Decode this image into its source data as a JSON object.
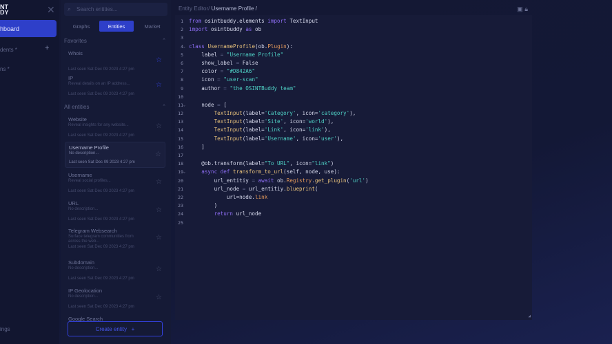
{
  "sidebar": {
    "logo_top": "NT",
    "logo_bottom": "DY",
    "items": [
      {
        "label": "hboard"
      },
      {
        "label": "dents *"
      },
      {
        "label": "ns *"
      }
    ],
    "settings_label": "ings"
  },
  "panel": {
    "search_placeholder": "Search entities...",
    "tabs": [
      {
        "label": "Graphs"
      },
      {
        "label": "Entities"
      },
      {
        "label": "Market"
      }
    ],
    "favorites_label": "Favorites",
    "all_label": "All entities",
    "favorites": [
      {
        "title": "Whois",
        "desc": "",
        "seen": "Last seen Sat Dec 09 2023 4:27 pm"
      },
      {
        "title": "IP",
        "desc": "Reveal details on an IP address...",
        "seen": "Last seen Sat Dec 09 2023 4:27 pm"
      }
    ],
    "entities": [
      {
        "title": "Website",
        "desc": "Reveal insights for any website...",
        "seen": "Last seen Sat Dec 09 2023 4:27 pm"
      },
      {
        "title": "Username Profile",
        "desc": "No description...",
        "seen": "Last seen Sat Dec 09 2023 4:27 pm"
      },
      {
        "title": "Username",
        "desc": "Reveal social profiles...",
        "seen": "Last seen Sat Dec 09 2023 4:27 pm"
      },
      {
        "title": "URL",
        "desc": "No description...",
        "seen": "Last seen Sat Dec 09 2023 4:27 pm"
      },
      {
        "title": "Telegram Websearch",
        "desc": "Surface telegram communities from across the web...",
        "seen": "Last seen Sat Dec 09 2023 4:27 pm"
      },
      {
        "title": "Subdomain",
        "desc": "No description...",
        "seen": "Last seen Sat Dec 09 2023 4:27 pm"
      },
      {
        "title": "IP Geolocation",
        "desc": "No description...",
        "seen": "Last seen Sat Dec 09 2023 4:27 pm"
      },
      {
        "title": "Google Search",
        "desc": "",
        "seen": ""
      }
    ],
    "create_label": "Create entity"
  },
  "editor": {
    "crumb_root": "Entity Editor/",
    "crumb_current": "Username Profile /",
    "lines": [
      [
        [
          "kw",
          "from "
        ],
        [
          "tx",
          "osintbuddy.elements "
        ],
        [
          "kw",
          "import "
        ],
        [
          "tx",
          "TextInput"
        ]
      ],
      [
        [
          "kw",
          "import "
        ],
        [
          "tx",
          "osintbuddy "
        ],
        [
          "kw",
          "as "
        ],
        [
          "tx",
          "ob"
        ]
      ],
      [],
      [
        [
          "kw",
          "class "
        ],
        [
          "cl",
          "UsernameProfile"
        ],
        [
          "tx",
          "(ob."
        ],
        [
          "at",
          "Plugin"
        ],
        [
          "tx",
          "):"
        ]
      ],
      [
        [
          "tx",
          "    label "
        ],
        [
          "op",
          "= "
        ],
        [
          "st",
          "\"Username Profile\""
        ]
      ],
      [
        [
          "tx",
          "    show_label "
        ],
        [
          "op",
          "= "
        ],
        [
          "tx",
          "False"
        ]
      ],
      [
        [
          "tx",
          "    color "
        ],
        [
          "op",
          "= "
        ],
        [
          "st",
          "\"#D842A6\""
        ]
      ],
      [
        [
          "tx",
          "    icon "
        ],
        [
          "op",
          "= "
        ],
        [
          "st",
          "\"user-scan\""
        ]
      ],
      [
        [
          "tx",
          "    author "
        ],
        [
          "op",
          "= "
        ],
        [
          "st",
          "\"the OSINTBuddy team\""
        ]
      ],
      [],
      [
        [
          "tx",
          "    node "
        ],
        [
          "op",
          "= "
        ],
        [
          "tx",
          "["
        ]
      ],
      [
        [
          "tx",
          "        "
        ],
        [
          "cl",
          "TextInput"
        ],
        [
          "tx",
          "(label="
        ],
        [
          "st",
          "'Category'"
        ],
        [
          "tx",
          ", icon="
        ],
        [
          "st",
          "'category'"
        ],
        [
          "tx",
          "),"
        ]
      ],
      [
        [
          "tx",
          "        "
        ],
        [
          "cl",
          "TextInput"
        ],
        [
          "tx",
          "(label="
        ],
        [
          "st",
          "'Site'"
        ],
        [
          "tx",
          ", icon="
        ],
        [
          "st",
          "'world'"
        ],
        [
          "tx",
          "),"
        ]
      ],
      [
        [
          "tx",
          "        "
        ],
        [
          "cl",
          "TextInput"
        ],
        [
          "tx",
          "(label="
        ],
        [
          "st",
          "'Link'"
        ],
        [
          "tx",
          ", icon="
        ],
        [
          "st",
          "'link'"
        ],
        [
          "tx",
          "),"
        ]
      ],
      [
        [
          "tx",
          "        "
        ],
        [
          "cl",
          "TextInput"
        ],
        [
          "tx",
          "(label="
        ],
        [
          "st",
          "'Username'"
        ],
        [
          "tx",
          ", icon="
        ],
        [
          "st",
          "'user'"
        ],
        [
          "tx",
          "),"
        ]
      ],
      [
        [
          "tx",
          "    ]"
        ]
      ],
      [],
      [
        [
          "tx",
          "    @ob.transform(label="
        ],
        [
          "st",
          "\"To URL\""
        ],
        [
          "tx",
          ", icon="
        ],
        [
          "st",
          "\"link\""
        ],
        [
          "tx",
          ")"
        ]
      ],
      [
        [
          "kw",
          "    async def "
        ],
        [
          "cl",
          "transform_to_url"
        ],
        [
          "tx",
          "(self, node, use):"
        ]
      ],
      [
        [
          "tx",
          "        url_entitiy "
        ],
        [
          "op",
          "= "
        ],
        [
          "kw",
          "await "
        ],
        [
          "tx",
          "ob."
        ],
        [
          "at",
          "Registry"
        ],
        [
          "tx",
          "."
        ],
        [
          "cl",
          "get_plugin"
        ],
        [
          "tx",
          "("
        ],
        [
          "st",
          "'url'"
        ],
        [
          "tx",
          ")"
        ]
      ],
      [
        [
          "tx",
          "        url_node "
        ],
        [
          "op",
          "= "
        ],
        [
          "tx",
          "url_entitiy."
        ],
        [
          "cl",
          "blueprint"
        ],
        [
          "tx",
          "("
        ]
      ],
      [
        [
          "tx",
          "            url=node."
        ],
        [
          "at",
          "link"
        ]
      ],
      [
        [
          "tx",
          "        )"
        ]
      ],
      [
        [
          "kw",
          "        return "
        ],
        [
          "tx",
          "url_node"
        ]
      ],
      []
    ],
    "folds": [
      4,
      11,
      19
    ]
  }
}
